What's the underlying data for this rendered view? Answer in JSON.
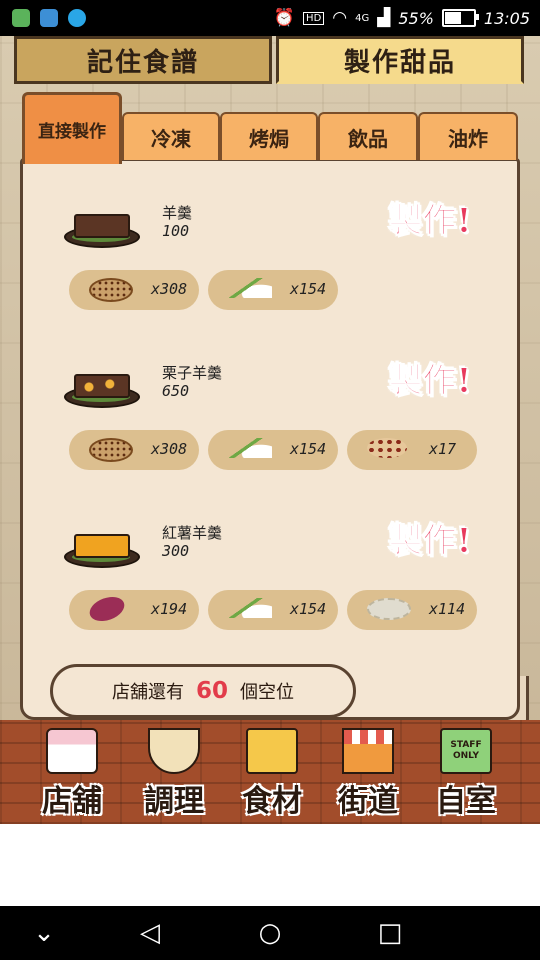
{
  "status_bar": {
    "icons": [
      "chat-app-icon",
      "mail-app-icon",
      "message-app-icon"
    ],
    "alarm_icon": "alarm-icon",
    "hd_label": "HD",
    "network_label": "4G",
    "battery_percent": "55%",
    "battery_level": 0.55,
    "time": "13:05"
  },
  "top_tabs": {
    "recipes_label": "記住食譜",
    "make_sweets_label": "製作甜品"
  },
  "category_tabs": [
    "直接製作",
    "冷凍",
    "烤焗",
    "飲品",
    "油炸"
  ],
  "make_label": "製作!",
  "recipes": [
    {
      "name": "羊羹",
      "price": "100",
      "ingredients": [
        {
          "icon": "red-bean-seeds-icon",
          "count": "x308"
        },
        {
          "icon": "grass-and-sugar-icon",
          "count": "x154"
        }
      ]
    },
    {
      "name": "栗子羊羹",
      "price": "650",
      "ingredients": [
        {
          "icon": "red-bean-seeds-icon",
          "count": "x308"
        },
        {
          "icon": "grass-and-sugar-icon",
          "count": "x154"
        },
        {
          "icon": "chestnut-beans-icon",
          "count": "x17"
        }
      ]
    },
    {
      "name": "紅薯羊羹",
      "price": "300",
      "ingredients": [
        {
          "icon": "sweet-potato-icon",
          "count": "x194"
        },
        {
          "icon": "grass-and-sugar-icon",
          "count": "x154"
        },
        {
          "icon": "rice-cake-icon",
          "count": "x114"
        }
      ]
    }
  ],
  "seats": {
    "prefix": "店舖還有",
    "count": "60",
    "suffix": "個空位"
  },
  "bottom_nav": [
    {
      "label": "店舖",
      "icon": "cake-icon"
    },
    {
      "label": "調理",
      "icon": "mixing-bowl-icon"
    },
    {
      "label": "食材",
      "icon": "ingredient-bag-icon"
    },
    {
      "label": "街道",
      "icon": "shop-street-icon"
    },
    {
      "label": "自室",
      "icon": "staff-only-sign-icon",
      "sign_text": [
        "STAFF",
        "ONLY"
      ]
    }
  ],
  "system_nav": {
    "down": "⌄",
    "back": "◁",
    "home": "○",
    "recents": "□"
  },
  "colors": {
    "make_button": "#e83a5e",
    "seat_count": "#e23c4a",
    "active_category": "#ef8f45",
    "category": "#f7b267"
  }
}
